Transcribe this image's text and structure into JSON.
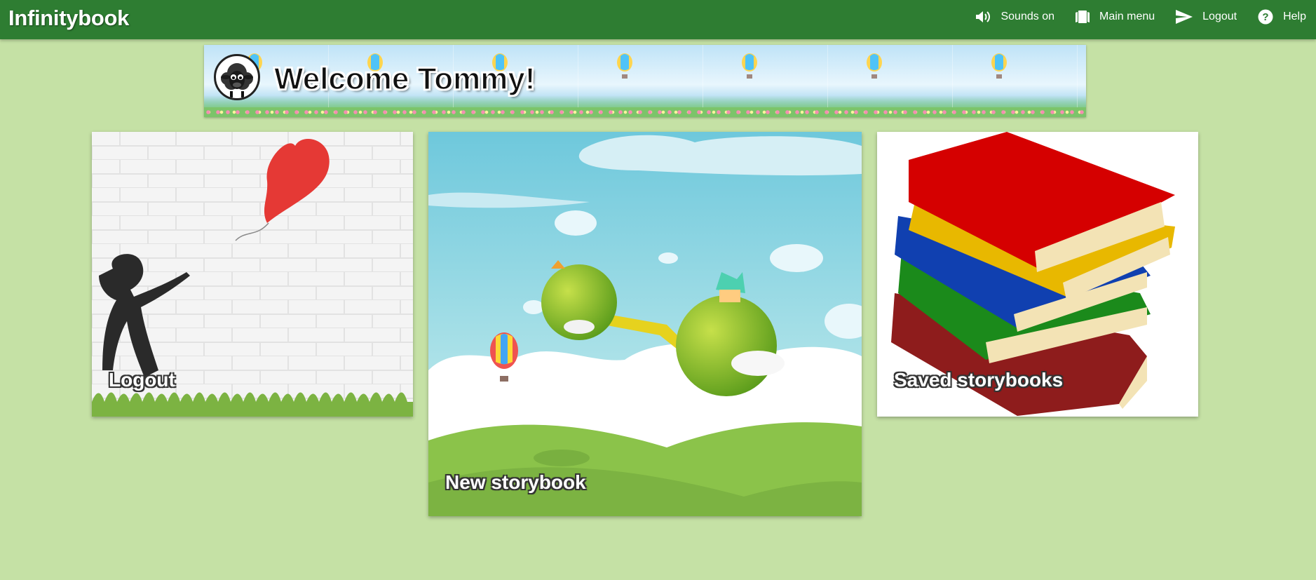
{
  "app": {
    "brand": "Infinitybook"
  },
  "nav": {
    "items": [
      {
        "id": "sounds",
        "label": "Sounds on",
        "icon": "speaker-icon"
      },
      {
        "id": "main-menu",
        "label": "Main menu",
        "icon": "book-icon"
      },
      {
        "id": "logout",
        "label": "Logout",
        "icon": "send-icon"
      },
      {
        "id": "help",
        "label": "Help",
        "icon": "help-icon"
      }
    ]
  },
  "banner": {
    "welcome": "Welcome Tommy!",
    "avatar_icon": "sheep-avatar"
  },
  "cards": {
    "logout": {
      "label": "Logout",
      "image": "girl-with-balloon"
    },
    "new_storybook": {
      "label": "New storybook",
      "image": "floating-islands"
    },
    "saved_storybooks": {
      "label": "Saved storybooks",
      "image": "stack-of-books"
    }
  },
  "colors": {
    "navbar": "#2e7d32",
    "background": "#c5e1a5"
  }
}
